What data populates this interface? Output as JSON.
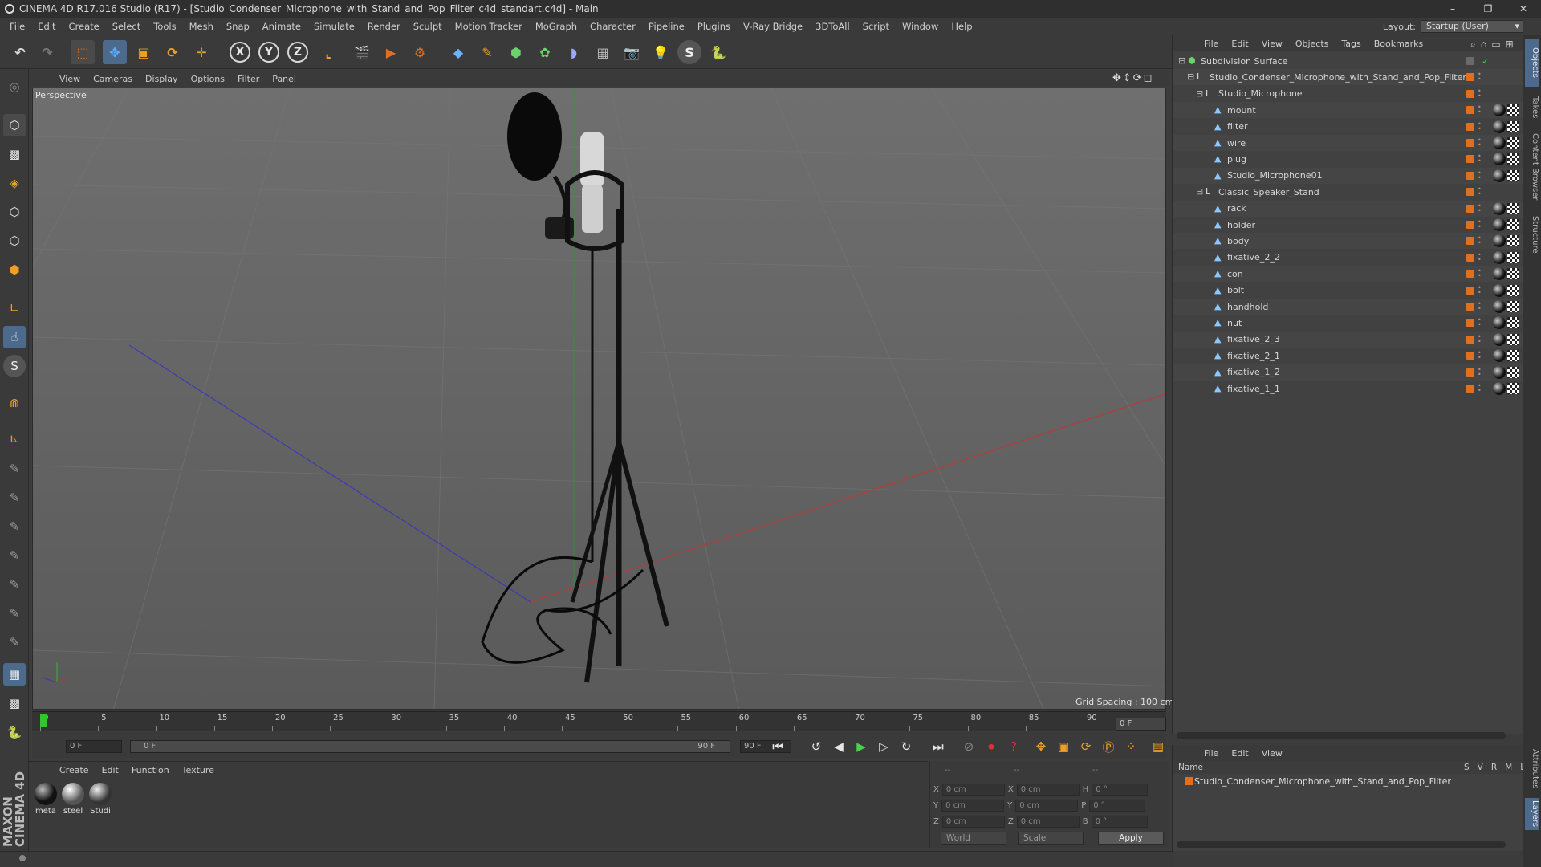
{
  "window": {
    "title": "CINEMA 4D R17.016 Studio (R17) - [Studio_Condenser_Microphone_with_Stand_and_Pop_Filter_c4d_standart.c4d] - Main",
    "controls": [
      "–",
      "❐",
      "✕"
    ]
  },
  "menubar": [
    "File",
    "Edit",
    "Create",
    "Select",
    "Tools",
    "Mesh",
    "Snap",
    "Animate",
    "Simulate",
    "Render",
    "Sculpt",
    "Motion Tracker",
    "MoGraph",
    "Character",
    "Pipeline",
    "Plugins",
    "V-Ray Bridge",
    "3DToAll",
    "Script",
    "Window",
    "Help"
  ],
  "layout": {
    "label": "Layout:",
    "value": "Startup (User)"
  },
  "toolbar": {
    "axis_x": "X",
    "axis_y": "Y",
    "axis_z": "Z"
  },
  "viewport": {
    "menu": [
      "View",
      "Cameras",
      "Display",
      "Options",
      "Filter",
      "Panel"
    ],
    "label": "Perspective",
    "grid_spacing": "Grid Spacing : 100 cm"
  },
  "timeline": {
    "ticks": [
      "0",
      "5",
      "10",
      "15",
      "20",
      "25",
      "30",
      "35",
      "40",
      "45",
      "50",
      "55",
      "60",
      "65",
      "70",
      "75",
      "80",
      "85",
      "90"
    ],
    "current_frame_right": "0 F"
  },
  "transport": {
    "start": "0 F",
    "range_start": "0 F",
    "range_end": "90 F",
    "end": "90 F"
  },
  "materials": {
    "menu": [
      "Create",
      "Edit",
      "Function",
      "Texture"
    ],
    "items": [
      {
        "name": "meta"
      },
      {
        "name": "steel"
      },
      {
        "name": "Studi"
      }
    ]
  },
  "coords": {
    "header1": "--",
    "header2": "--",
    "header3": "--",
    "rows": [
      {
        "a": "X",
        "av": "0 cm",
        "b": "X",
        "bv": "0 cm",
        "c": "H",
        "cv": "0 °"
      },
      {
        "a": "Y",
        "av": "0 cm",
        "b": "Y",
        "bv": "0 cm",
        "c": "P",
        "cv": "0 °"
      },
      {
        "a": "Z",
        "av": "0 cm",
        "b": "Z",
        "bv": "0 cm",
        "c": "B",
        "cv": "0 °"
      }
    ],
    "mode": "World",
    "scale": "Scale",
    "apply": "Apply"
  },
  "objects": {
    "menu": [
      "File",
      "Edit",
      "View",
      "Objects",
      "Tags",
      "Bookmarks"
    ],
    "tree": [
      {
        "name": "Subdivision Surface",
        "level": 0
      },
      {
        "name": "Studio_Condenser_Microphone_with_Stand_and_Pop_Filter",
        "level": 1
      },
      {
        "name": "Studio_Microphone",
        "level": 2
      },
      {
        "name": "mount",
        "level": 3
      },
      {
        "name": "filter",
        "level": 3
      },
      {
        "name": "wire",
        "level": 3
      },
      {
        "name": "plug",
        "level": 3
      },
      {
        "name": "Studio_Microphone01",
        "level": 3
      },
      {
        "name": "Classic_Speaker_Stand",
        "level": 2
      },
      {
        "name": "rack",
        "level": 3
      },
      {
        "name": "holder",
        "level": 3
      },
      {
        "name": "body",
        "level": 3
      },
      {
        "name": "fixative_2_2",
        "level": 3
      },
      {
        "name": "con",
        "level": 3
      },
      {
        "name": "bolt",
        "level": 3
      },
      {
        "name": "handhold",
        "level": 3
      },
      {
        "name": "nut",
        "level": 3
      },
      {
        "name": "fixative_2_3",
        "level": 3
      },
      {
        "name": "fixative_2_1",
        "level": 3
      },
      {
        "name": "fixative_1_2",
        "level": 3
      },
      {
        "name": "fixative_1_1",
        "level": 3
      }
    ]
  },
  "layers": {
    "menu": [
      "File",
      "Edit",
      "View"
    ],
    "head_name": "Name",
    "head_cols": [
      "S",
      "V",
      "R",
      "M",
      "L"
    ],
    "row": "Studio_Condenser_Microphone_with_Stand_and_Pop_Filter"
  },
  "side_tabs": [
    "Objects",
    "Takes",
    "Content Browser",
    "Structure",
    "Attributes",
    "Layers"
  ],
  "brand": "MAXON CINEMA 4D",
  "colors": {
    "accent_orange": "#e07020",
    "selection_blue": "#3d6ea8"
  }
}
